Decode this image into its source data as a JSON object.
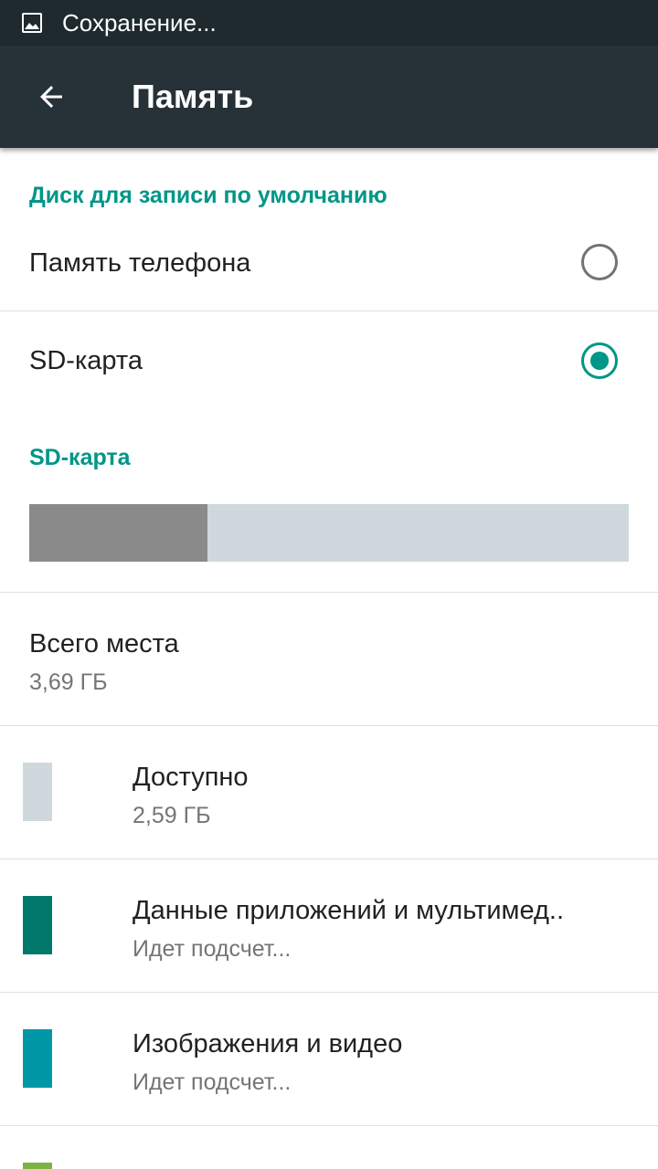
{
  "status_bar": {
    "icon": "image-icon",
    "text": "Сохранение..."
  },
  "app_bar": {
    "back_icon": "arrow-back-icon",
    "title": "Память"
  },
  "default_disk": {
    "header": "Диск для записи по умолчанию",
    "options": [
      {
        "label": "Память телефона",
        "selected": false
      },
      {
        "label": "SD-карта",
        "selected": true
      }
    ]
  },
  "sd_card": {
    "header": "SD-карта",
    "used_fraction": 0.297,
    "used_color": "#8a8a8a",
    "free_color": "#cfd8dc"
  },
  "items": [
    {
      "title": "Всего места",
      "value": "3,69 ГБ"
    },
    {
      "title": "Доступно",
      "value": "2,59 ГБ",
      "color": "#cfd8dc"
    },
    {
      "title": "Данные приложений и мультимед..",
      "value": "Идет подсчет...",
      "color": "#00796b"
    },
    {
      "title": "Изображения и видео",
      "value": "Идет подсчет...",
      "color": "#0097a7"
    },
    {
      "title": "",
      "value": "",
      "color": "#7cb342"
    }
  ],
  "accent_color": "#009688"
}
